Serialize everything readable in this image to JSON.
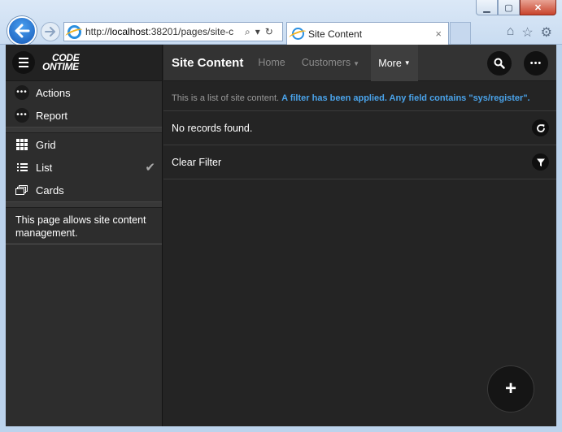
{
  "browser": {
    "url_prefix": "http://",
    "url_host": "localhost",
    "url_rest": ":38201/pages/site-c",
    "tab_title": "Site Content",
    "tab_close": "×",
    "window_min": "▁",
    "window_max": "▢",
    "window_close": "✕",
    "icons": [
      "home-icon",
      "favorites-star-icon",
      "settings-gear-icon"
    ]
  },
  "app": {
    "logo_line1": "CODE",
    "logo_line2": "ONTIME",
    "page_title": "Site Content",
    "topnav": {
      "home": "Home",
      "customers": "Customers",
      "more": "More"
    },
    "sidebar": {
      "actions": [
        {
          "label": "Actions",
          "icon": "more-dots-icon"
        },
        {
          "label": "Report",
          "icon": "more-dots-icon"
        }
      ],
      "views": [
        {
          "label": "Grid",
          "icon": "grid-icon"
        },
        {
          "label": "List",
          "icon": "list-icon",
          "selected": true
        },
        {
          "label": "Cards",
          "icon": "cards-icon"
        }
      ],
      "description": "This page allows site content management."
    },
    "info": {
      "text": "This is a list of site content.",
      "filter_text": "A filter has been applied. Any field contains \"sys/register\"."
    },
    "rows": {
      "empty": "No records found.",
      "clear_filter": "Clear Filter"
    },
    "fab_label": "+",
    "accent_color": "#4aa3ea"
  }
}
